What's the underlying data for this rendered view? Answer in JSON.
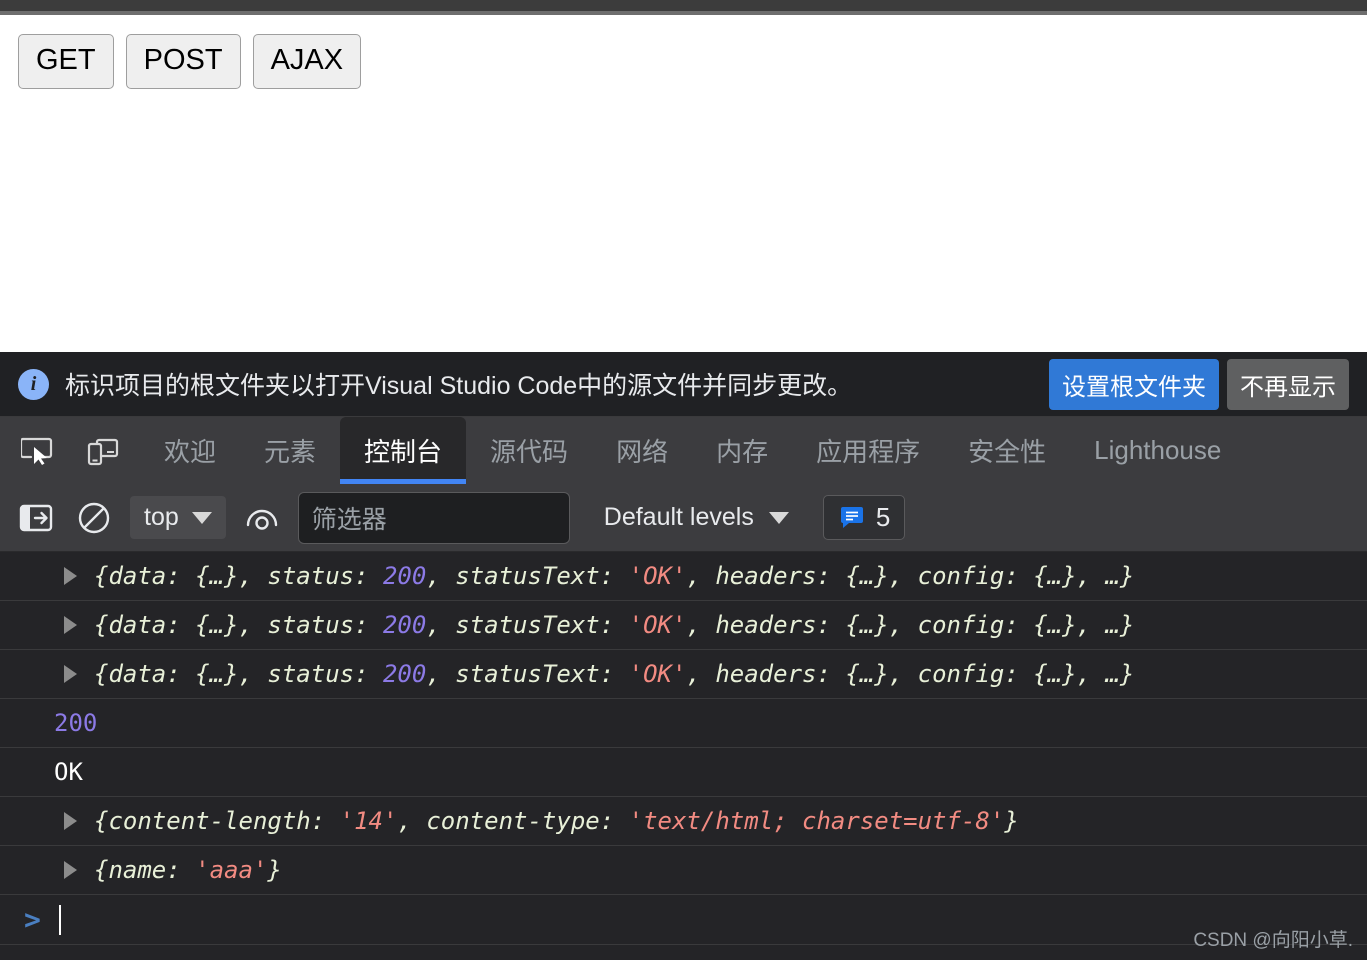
{
  "page": {
    "buttons": [
      {
        "label": "GET",
        "name": "get-button"
      },
      {
        "label": "POST",
        "name": "post-button"
      },
      {
        "label": "AJAX",
        "name": "ajax-button"
      }
    ]
  },
  "banner": {
    "icon": "info-icon",
    "message": "标识项目的根文件夹以打开Visual Studio Code中的源文件并同步更改。",
    "primary_button": "设置根文件夹",
    "secondary_button": "不再显示",
    "primary_color": "#3079d6",
    "secondary_color": "#5f6061"
  },
  "devtools": {
    "icons": [
      {
        "name": "inspect-element-icon"
      },
      {
        "name": "device-toolbar-icon"
      }
    ],
    "tabs": [
      {
        "label": "欢迎",
        "name": "tab-welcome",
        "active": false
      },
      {
        "label": "元素",
        "name": "tab-elements",
        "active": false
      },
      {
        "label": "控制台",
        "name": "tab-console",
        "active": true
      },
      {
        "label": "源代码",
        "name": "tab-sources",
        "active": false
      },
      {
        "label": "网络",
        "name": "tab-network",
        "active": false
      },
      {
        "label": "内存",
        "name": "tab-memory",
        "active": false
      },
      {
        "label": "应用程序",
        "name": "tab-application",
        "active": false
      },
      {
        "label": "安全性",
        "name": "tab-security",
        "active": false
      },
      {
        "label": "Lighthouse",
        "name": "tab-lighthouse",
        "active": false
      }
    ],
    "active_tab_accent": "#4285f4"
  },
  "console_toolbar": {
    "sidebar_toggle_icon": "show-console-sidebar-icon",
    "clear_icon": "clear-console-icon",
    "context": "top",
    "eye_icon": "live-expression-icon",
    "filter_placeholder": "筛选器",
    "levels": "Default levels",
    "message_count": "5",
    "badge_color": "#1a73e8"
  },
  "console_rows": [
    {
      "name": "log-row-response-1",
      "expandable": true,
      "segments": [
        {
          "text": "{data: {…}, status: ",
          "cls": "key"
        },
        {
          "text": "200",
          "cls": "num"
        },
        {
          "text": ", statusText: ",
          "cls": "key"
        },
        {
          "text": "'OK'",
          "cls": "str"
        },
        {
          "text": ", headers: {…}, config: {…}, …}",
          "cls": "key"
        }
      ]
    },
    {
      "name": "log-row-response-2",
      "expandable": true,
      "segments": [
        {
          "text": "{data: {…}, status: ",
          "cls": "key"
        },
        {
          "text": "200",
          "cls": "num"
        },
        {
          "text": ", statusText: ",
          "cls": "key"
        },
        {
          "text": "'OK'",
          "cls": "str"
        },
        {
          "text": ", headers: {…}, config: {…}, …}",
          "cls": "key"
        }
      ]
    },
    {
      "name": "log-row-response-3",
      "expandable": true,
      "segments": [
        {
          "text": "{data: {…}, status: ",
          "cls": "key"
        },
        {
          "text": "200",
          "cls": "num"
        },
        {
          "text": ", statusText: ",
          "cls": "key"
        },
        {
          "text": "'OK'",
          "cls": "str"
        },
        {
          "text": ", headers: {…}, config: {…}, …}",
          "cls": "key"
        }
      ]
    },
    {
      "name": "log-row-status-code",
      "expandable": false,
      "plain": true,
      "segments": [
        {
          "text": "200",
          "cls": "num"
        }
      ]
    },
    {
      "name": "log-row-status-text",
      "expandable": false,
      "plain": true,
      "segments": [
        {
          "text": "OK",
          "cls": "white"
        }
      ]
    },
    {
      "name": "log-row-headers",
      "expandable": true,
      "segments": [
        {
          "text": "{content-length: ",
          "cls": "key"
        },
        {
          "text": "'14'",
          "cls": "str"
        },
        {
          "text": ", content-type: ",
          "cls": "key"
        },
        {
          "text": "'text/html; charset=utf-8'",
          "cls": "str"
        },
        {
          "text": "}",
          "cls": "key"
        }
      ]
    },
    {
      "name": "log-row-data",
      "expandable": true,
      "segments": [
        {
          "text": "{name: ",
          "cls": "key"
        },
        {
          "text": "'aaa'",
          "cls": "str"
        },
        {
          "text": "}",
          "cls": "key"
        }
      ]
    }
  ],
  "prompt": {
    "chevron": ">",
    "value": ""
  },
  "watermark": "CSDN @向阳小草."
}
